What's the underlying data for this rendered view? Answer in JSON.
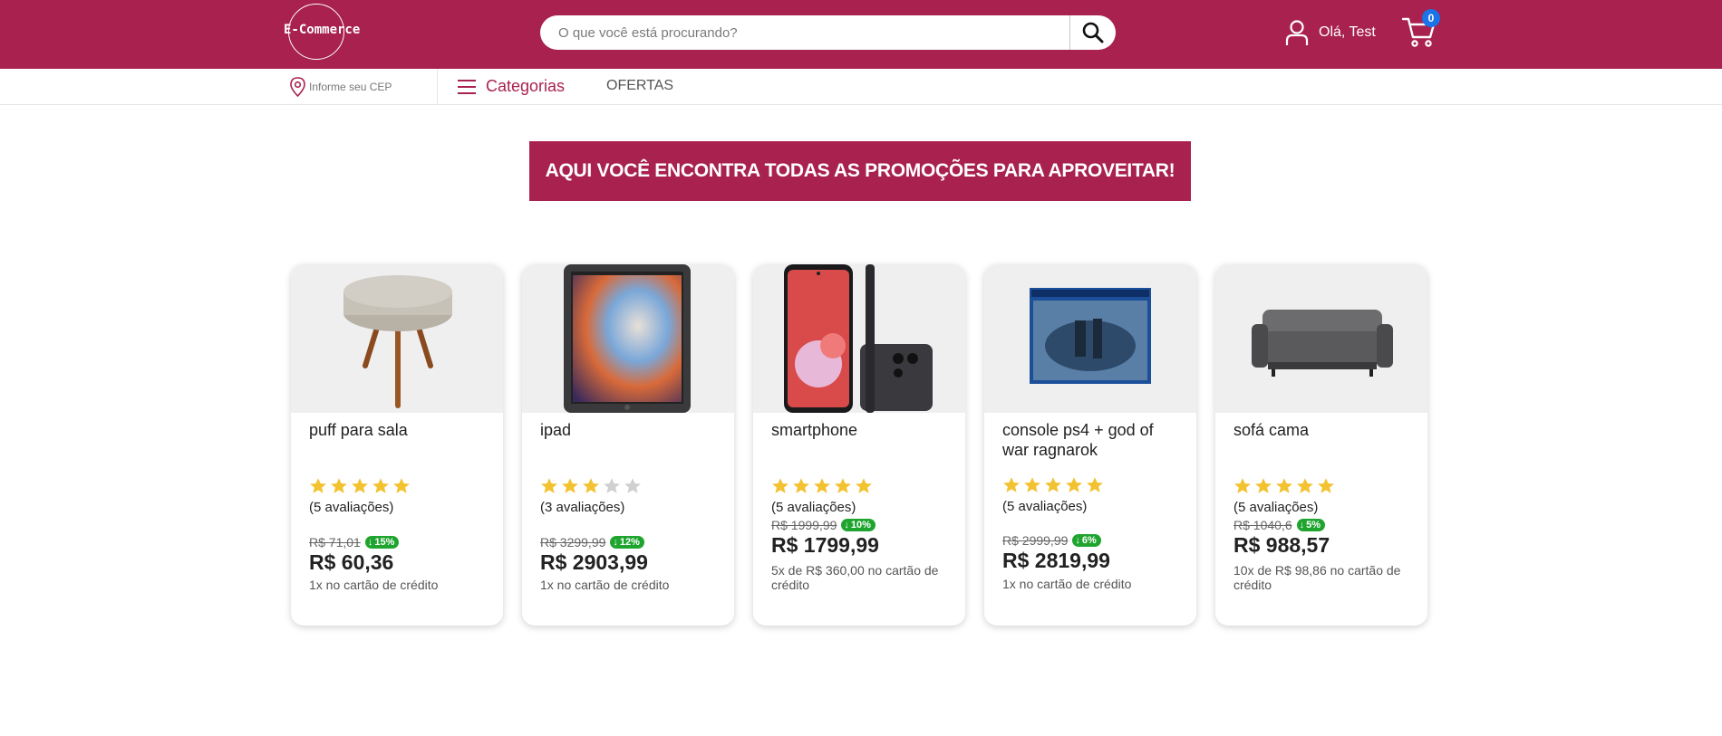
{
  "header": {
    "logo_text": "E-Commerce",
    "search_placeholder": "O que você está procurando?",
    "user_greeting": "Olá, Test",
    "cart_count": "0",
    "brand_color": "#a8214f"
  },
  "subnav": {
    "cep_label": "Informe seu CEP",
    "categorias_label": "Categorias",
    "ofertas_label": "OFERTAS"
  },
  "banner": {
    "text": "AQUI VOCÊ ENCONTRA TODAS AS PROMOÇÕES PARA APROVEITAR!"
  },
  "products": [
    {
      "name": "puff para sala",
      "rating": 5,
      "reviews": "(5 avaliações)",
      "old_price": "R$ 71,01",
      "discount": "15%",
      "price": "R$ 60,36",
      "installments": "1x no cartão de crédito",
      "image_icon": "puff-image"
    },
    {
      "name": "ipad",
      "rating": 3,
      "reviews": "(3 avaliações)",
      "old_price": "R$ 3299,99",
      "discount": "12%",
      "price": "R$ 2903,99",
      "installments": "1x no cartão de crédito",
      "image_icon": "tablet-image"
    },
    {
      "name": "smartphone",
      "rating": 5,
      "reviews": "(5 avaliações)",
      "old_price": "R$ 1999,99",
      "discount": "10%",
      "price": "R$ 1799,99",
      "installments": "5x de R$ 360,00 no cartão de crédito",
      "image_icon": "smartphone-image"
    },
    {
      "name": "console ps4 + god of war ragnarok",
      "rating": 5,
      "reviews": "(5 avaliações)",
      "old_price": "R$ 2999,99",
      "discount": "6%",
      "price": "R$ 2819,99",
      "installments": "1x no cartão de crédito",
      "image_icon": "console-box-image"
    },
    {
      "name": "sofá cama",
      "rating": 5,
      "reviews": "(5 avaliações)",
      "old_price": "R$ 1040,6",
      "discount": "5%",
      "price": "R$ 988,57",
      "installments": "10x de R$ 98,86 no cartão de crédito",
      "image_icon": "sofa-image"
    }
  ]
}
